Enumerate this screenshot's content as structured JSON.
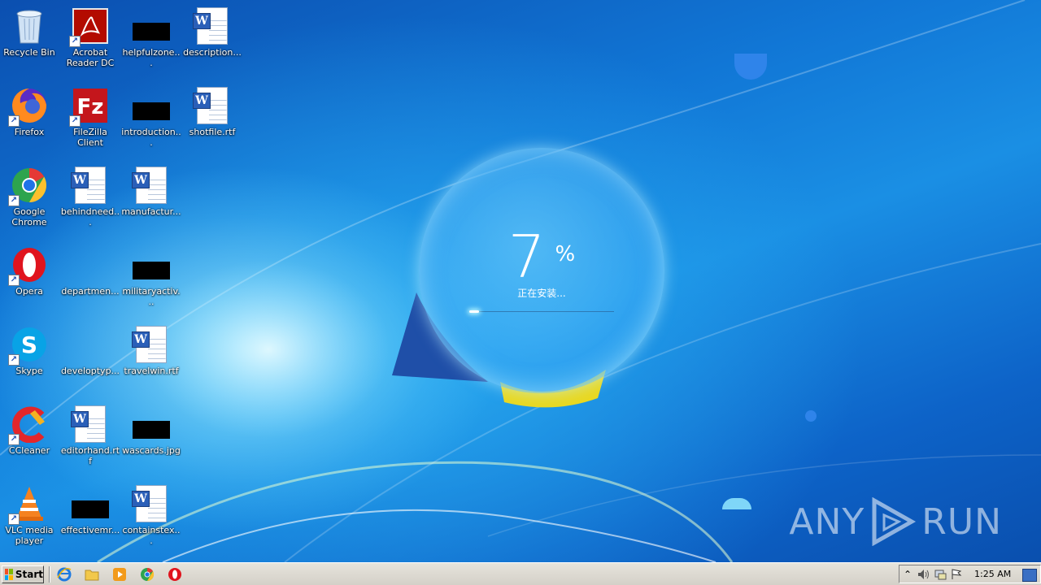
{
  "desktop": {
    "icons": [
      {
        "label": "Recycle Bin",
        "icon": "recycle-bin-icon"
      },
      {
        "label": "Acrobat Reader DC",
        "icon": "acrobat-icon"
      },
      {
        "label": "helpfulzone...",
        "icon": "redacted-file-icon"
      },
      {
        "label": "description...",
        "icon": "word-document-icon"
      },
      {
        "label": "Firefox",
        "icon": "firefox-icon"
      },
      {
        "label": "FileZilla Client",
        "icon": "filezilla-icon"
      },
      {
        "label": "introduction...",
        "icon": "redacted-file-icon"
      },
      {
        "label": "shotfile.rtf",
        "icon": "word-document-icon"
      },
      {
        "label": "Google Chrome",
        "icon": "chrome-icon"
      },
      {
        "label": "behindneed...",
        "icon": "word-document-icon"
      },
      {
        "label": "manufactur...",
        "icon": "word-document-icon"
      },
      {
        "label": "Opera",
        "icon": "opera-icon"
      },
      {
        "label": "departmen...",
        "icon": "blank-file-icon"
      },
      {
        "label": "militaryactiv...",
        "icon": "redacted-file-icon"
      },
      {
        "label": "Skype",
        "icon": "skype-icon"
      },
      {
        "label": "developtyp...",
        "icon": "blank-file-icon"
      },
      {
        "label": "travelwin.rtf",
        "icon": "word-document-icon"
      },
      {
        "label": "CCleaner",
        "icon": "ccleaner-icon"
      },
      {
        "label": "editorhand.rtf",
        "icon": "word-document-icon"
      },
      {
        "label": "wascards.jpg",
        "icon": "redacted-file-icon"
      },
      {
        "label": "VLC media player",
        "icon": "vlc-icon"
      },
      {
        "label": "effectivemr...",
        "icon": "redacted-file-icon"
      },
      {
        "label": "containstex...",
        "icon": "word-document-icon"
      }
    ]
  },
  "installer": {
    "percent": "7",
    "percent_symbol": "%",
    "status": "正在安装...",
    "progress": 0.07
  },
  "watermark": {
    "left": "ANY",
    "right": "RUN"
  },
  "taskbar": {
    "start_label": "Start",
    "quick_launch": [
      "ie-icon",
      "folder-icon",
      "media-player-icon",
      "chrome-icon",
      "opera-icon"
    ],
    "tray_icons": [
      "chevron-up-icon",
      "speaker-icon",
      "network-icon",
      "flag-icon"
    ],
    "clock": "1:25 AM"
  },
  "colors": {
    "accent": "#1a8fe4",
    "taskbar": "#d4d0c8"
  }
}
